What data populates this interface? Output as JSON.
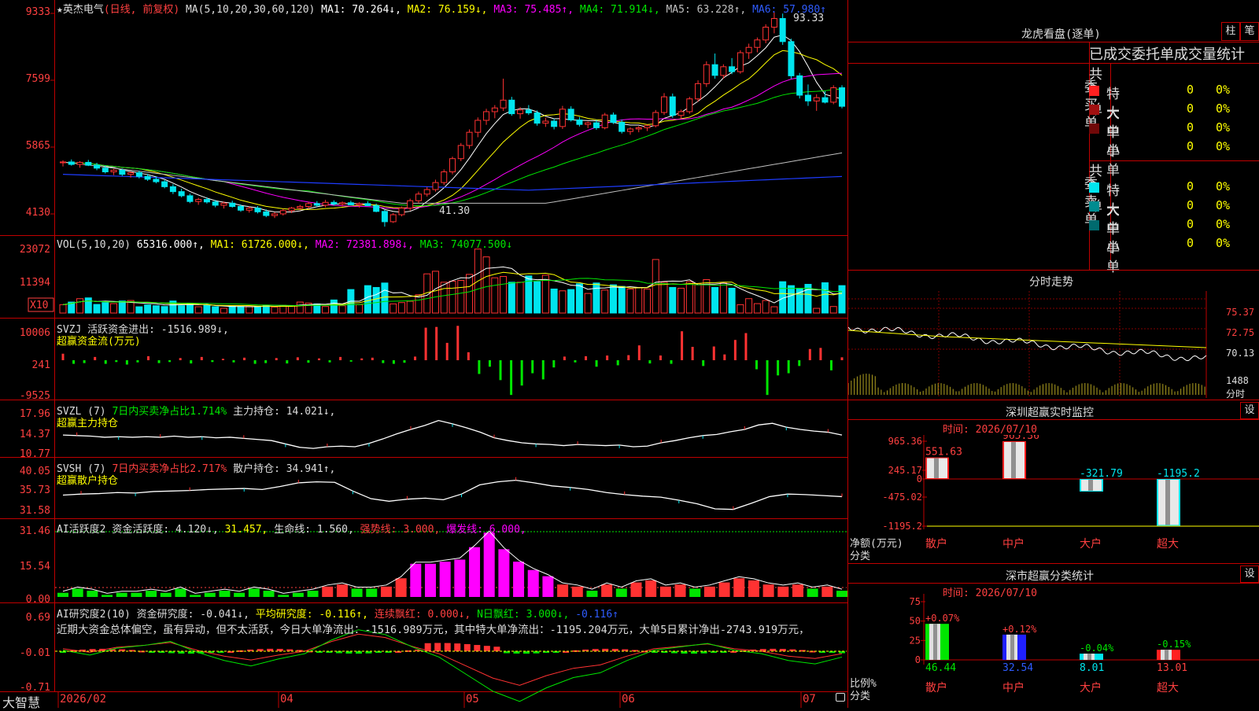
{
  "app": {
    "brand": "大智慧"
  },
  "stock": {
    "star": "★",
    "name": "英杰电气",
    "period": "(日线, 前复权)"
  },
  "colors": {
    "up": "#ff3232",
    "down": "#00e5ee",
    "axis": "#c00000",
    "grid": "#800000",
    "ma1": "#ffffff",
    "ma2": "#ffff00",
    "ma3": "#ff00ff",
    "ma4": "#00e600",
    "ma5": "#c0c0c0",
    "ma6": "#1e3cff",
    "label_red": "#ff4040"
  },
  "panels": {
    "price": {
      "header": [
        {
          "text": "MA(5,10,20,30,60,120)",
          "color": "#dddddd"
        },
        {
          "text": "MA1: 70.264↓,",
          "color": "#ffffff"
        },
        {
          "text": "MA2: 76.159↓,",
          "color": "#ffff00"
        },
        {
          "text": "MA3: 75.485↑,",
          "color": "#ff00ff"
        },
        {
          "text": "MA4: 71.914↓,",
          "color": "#00e600"
        },
        {
          "text": "MA5: 63.228↑,",
          "color": "#c0c0c0"
        },
        {
          "text": "MA6: 57.980↑",
          "color": "#2f5cff"
        }
      ],
      "y_ticks": [
        "9333",
        "7599",
        "5865",
        "4130"
      ],
      "high_label": "93.33",
      "low_label": "41.30"
    },
    "vol": {
      "header": [
        {
          "text": "VOL(5,10,20)",
          "color": "#dddddd"
        },
        {
          "text": "65316.000↑,",
          "color": "#ffffff"
        },
        {
          "text": "MA1: 61726.000↓,",
          "color": "#ffff00"
        },
        {
          "text": "MA2: 72381.898↓,",
          "color": "#ff00ff"
        },
        {
          "text": "MA3: 74077.500↓",
          "color": "#00e600"
        }
      ],
      "y_ticks": [
        "23072",
        "11394"
      ],
      "unit": "X10"
    },
    "svzj": {
      "header": [
        {
          "text": "SVZJ",
          "color": "#dddddd"
        },
        {
          "text": "活跃资金进出: -1516.989↓,",
          "color": "#dddddd"
        }
      ],
      "subtitle": "超赢资金流(万元)",
      "y_ticks": [
        "10006",
        "241",
        "-9525"
      ]
    },
    "svzl": {
      "header": [
        {
          "text": "SVZL (7)",
          "color": "#dddddd"
        },
        {
          "text": "7日内买卖净占比1.714%",
          "color": "#00e600"
        },
        {
          "text": "主力持仓: 14.021↓,",
          "color": "#dddddd"
        }
      ],
      "subtitle": "超赢主力持仓",
      "y_ticks": [
        "17.96",
        "14.37",
        "10.77"
      ]
    },
    "svsh": {
      "header": [
        {
          "text": "SVSH (7)",
          "color": "#dddddd"
        },
        {
          "text": "7日内买卖净占比2.717%",
          "color": "#ff4040"
        },
        {
          "text": "散户持仓: 34.941↑,",
          "color": "#dddddd"
        }
      ],
      "subtitle": "超赢散户持仓",
      "y_ticks": [
        "40.05",
        "35.73",
        "31.58"
      ]
    },
    "ai_active": {
      "header": [
        {
          "text": "AI活跃度2",
          "color": "#dddddd"
        },
        {
          "text": "资金活跃度: 4.120↓,",
          "color": "#dddddd"
        },
        {
          "text": "31.457,",
          "color": "#ffff00"
        },
        {
          "text": "生命线: 1.560,",
          "color": "#dddddd"
        },
        {
          "text": "强势线: 3.000,",
          "color": "#ff4040"
        },
        {
          "text": "爆发线: 6.000,",
          "color": "#ff00ff"
        }
      ],
      "y_ticks": [
        "31.46",
        "15.54",
        "0.00"
      ]
    },
    "ai_research": {
      "header": [
        {
          "text": "AI研究度2(10)",
          "color": "#dddddd"
        },
        {
          "text": "资金研究度: -0.041↓,",
          "color": "#dddddd"
        },
        {
          "text": "平均研究度: -0.116↑,",
          "color": "#ffff00"
        },
        {
          "text": "连续飘红: 0.000↓,",
          "color": "#ff4040"
        },
        {
          "text": "N日飘红: 3.000↓,",
          "color": "#00e600"
        },
        {
          "text": "-0.116↑",
          "color": "#2f5cff"
        }
      ],
      "comment": "近期大资金总体偏空，虽有异动，但不太活跃，今日大单净流出：-1516.989万元，其中特大单净流出：-1195.204万元，大单5日累计净出-2743.919万元，",
      "y_ticks": [
        "0.69",
        "-0.01",
        "-0.71"
      ]
    }
  },
  "x_axis": [
    "2026/02",
    "04",
    "05",
    "06",
    "07"
  ],
  "right": {
    "lhb": {
      "title": "龙虎看盘(逐单)",
      "btn1": "柱",
      "btn2": "笔",
      "subtitle": "已成交委托单成交量统计",
      "buy": {
        "label": "委买单",
        "total": "共 0单",
        "rows": [
          {
            "name": "特大",
            "color": "#ff2020",
            "val": "0",
            "pct": "0%"
          },
          {
            "name": "大单",
            "color": "#a01010",
            "val": "0",
            "pct": "0%"
          },
          {
            "name": "中单",
            "color": "#700808",
            "val": "0",
            "pct": "0%"
          },
          {
            "name": "小单",
            "color": "",
            "val": "0",
            "pct": "0%"
          }
        ]
      },
      "sell": {
        "label": "委卖单",
        "total": "共 0单",
        "rows": [
          {
            "name": "特大",
            "color": "#00e5ee",
            "val": "0",
            "pct": "0%"
          },
          {
            "name": "大单",
            "color": "#008c90",
            "val": "0",
            "pct": "0%"
          },
          {
            "name": "中单",
            "color": "#006a6e",
            "val": "0",
            "pct": "0%"
          },
          {
            "name": "小单",
            "color": "",
            "val": "0",
            "pct": "0%"
          }
        ]
      }
    },
    "intraday": {
      "title": "分时走势",
      "y_ticks": [
        "75.37",
        "72.75",
        "70.13"
      ],
      "vol_label": "1488",
      "bottom_label": "分时"
    },
    "monitor": {
      "title": "深圳超赢实时监控",
      "btn": "设",
      "time": "时间: 2026/07/10",
      "y_ticks": [
        "965.36",
        "245.17",
        "0",
        "-475.02",
        "-1195.2"
      ],
      "ylabel": "净额(万元)",
      "xlabel": "分类",
      "chart_data": {
        "type": "bar",
        "categories": [
          "散户",
          "中户",
          "大户",
          "超大"
        ],
        "values": [
          551.63,
          965.36,
          -321.79,
          -1195.2
        ],
        "ylim": [
          -1195.2,
          965.36
        ]
      }
    },
    "classify": {
      "title": "深市超赢分类统计",
      "btn": "设",
      "time": "时间: 2026/07/10",
      "y_ticks": [
        "75",
        "50",
        "25",
        "0"
      ],
      "ylabel": "比例%",
      "xlabel": "分类",
      "chart_data": {
        "type": "bar",
        "categories": [
          "散户",
          "中户",
          "大户",
          "超大"
        ],
        "values": [
          46.44,
          32.54,
          8.01,
          13.01
        ],
        "changes": [
          "+0.07%",
          "+0.12%",
          "-0.04%",
          "-0.15%"
        ],
        "ylim": [
          0,
          75
        ],
        "colors": [
          "#00e600",
          "#2020ff",
          "#00e5ee",
          "#ff2020"
        ]
      }
    }
  },
  "chart_data": {
    "type": "candlestick",
    "ohlc": [
      [
        56.8,
        57.4,
        55.9,
        57.0
      ],
      [
        57.0,
        57.6,
        56.1,
        56.4
      ],
      [
        56.4,
        57.2,
        55.6,
        56.9
      ],
      [
        56.9,
        57.5,
        56.0,
        56.2
      ],
      [
        56.2,
        56.8,
        55.0,
        55.5
      ],
      [
        55.5,
        56.1,
        54.2,
        54.6
      ],
      [
        54.6,
        55.3,
        53.8,
        55.0
      ],
      [
        55.0,
        55.4,
        53.6,
        54.0
      ],
      [
        54.0,
        54.7,
        53.2,
        54.4
      ],
      [
        54.4,
        54.9,
        53.0,
        53.5
      ],
      [
        53.5,
        54.1,
        52.4,
        52.8
      ],
      [
        52.8,
        53.5,
        51.8,
        52.2
      ],
      [
        52.2,
        52.6,
        50.6,
        51.0
      ],
      [
        51.0,
        51.6,
        49.2,
        49.8
      ],
      [
        49.8,
        50.5,
        48.4,
        48.8
      ],
      [
        48.8,
        49.3,
        47.0,
        47.4
      ],
      [
        47.4,
        48.3,
        46.6,
        47.9
      ],
      [
        47.9,
        48.4,
        46.9,
        47.3
      ],
      [
        47.3,
        47.8,
        46.0,
        46.5
      ],
      [
        46.5,
        47.4,
        45.7,
        47.0
      ],
      [
        47.0,
        47.6,
        45.9,
        46.2
      ],
      [
        46.2,
        46.7,
        44.9,
        45.3
      ],
      [
        45.3,
        46.2,
        44.7,
        45.8
      ],
      [
        45.8,
        46.3,
        44.5,
        44.9
      ],
      [
        44.9,
        45.5,
        43.6,
        44.0
      ],
      [
        44.0,
        44.8,
        43.4,
        44.4
      ],
      [
        44.4,
        45.6,
        44.0,
        45.2
      ],
      [
        45.2,
        46.1,
        44.6,
        45.8
      ],
      [
        45.8,
        46.6,
        45.3,
        46.2
      ],
      [
        46.2,
        47.3,
        45.6,
        46.9
      ],
      [
        46.9,
        47.5,
        46.1,
        46.5
      ],
      [
        46.5,
        47.8,
        46.0,
        47.2
      ],
      [
        47.2,
        47.7,
        46.4,
        46.8
      ],
      [
        46.8,
        47.4,
        46.2,
        47.1
      ],
      [
        47.1,
        47.6,
        46.5,
        46.6
      ],
      [
        46.6,
        47.2,
        45.9,
        46.9
      ],
      [
        46.9,
        47.5,
        46.3,
        46.4
      ],
      [
        46.4,
        46.9,
        44.8,
        45.0
      ],
      [
        45.0,
        45.4,
        41.3,
        42.5
      ],
      [
        42.5,
        44.6,
        42.2,
        44.2
      ],
      [
        44.2,
        46.2,
        43.8,
        45.8
      ],
      [
        45.8,
        48.1,
        45.2,
        47.6
      ],
      [
        47.6,
        49.8,
        47.0,
        49.2
      ],
      [
        49.2,
        50.9,
        48.6,
        50.3
      ],
      [
        50.3,
        52.7,
        49.8,
        52.0
      ],
      [
        52.0,
        55.2,
        51.4,
        54.6
      ],
      [
        54.6,
        58.3,
        54.0,
        57.8
      ],
      [
        57.8,
        61.6,
        57.2,
        61.0
      ],
      [
        61.0,
        64.9,
        60.2,
        64.2
      ],
      [
        64.2,
        67.8,
        63.0,
        67.1
      ],
      [
        67.1,
        69.9,
        66.0,
        69.2
      ],
      [
        69.2,
        70.8,
        67.6,
        70.1
      ],
      [
        70.1,
        77.2,
        69.4,
        72.0
      ],
      [
        72.0,
        72.8,
        68.2,
        68.7
      ],
      [
        68.7,
        70.3,
        67.5,
        69.6
      ],
      [
        69.6,
        70.8,
        68.4,
        68.9
      ],
      [
        68.9,
        69.5,
        65.8,
        66.4
      ],
      [
        66.4,
        67.7,
        65.5,
        66.9
      ],
      [
        66.9,
        67.5,
        64.9,
        65.6
      ],
      [
        65.6,
        70.6,
        65.0,
        69.8
      ],
      [
        69.8,
        70.5,
        66.8,
        67.2
      ],
      [
        67.2,
        67.9,
        65.6,
        66.1
      ],
      [
        66.1,
        66.8,
        65.2,
        66.5
      ],
      [
        66.5,
        67.2,
        64.8,
        65.3
      ],
      [
        65.3,
        68.9,
        64.9,
        68.4
      ],
      [
        68.4,
        69.0,
        66.2,
        66.6
      ],
      [
        66.6,
        67.3,
        63.9,
        64.4
      ],
      [
        64.4,
        65.4,
        63.6,
        65.0
      ],
      [
        65.0,
        65.7,
        64.2,
        65.3
      ],
      [
        65.3,
        66.1,
        64.5,
        65.8
      ],
      [
        65.8,
        69.6,
        65.4,
        69.0
      ],
      [
        69.0,
        73.7,
        68.4,
        72.8
      ],
      [
        72.8,
        73.6,
        67.7,
        68.3
      ],
      [
        68.3,
        69.7,
        67.5,
        69.2
      ],
      [
        69.2,
        72.8,
        68.7,
        72.3
      ],
      [
        72.3,
        76.8,
        71.6,
        76.0
      ],
      [
        76.0,
        81.4,
        75.2,
        80.6
      ],
      [
        80.6,
        83.3,
        77.2,
        78.0
      ],
      [
        78.0,
        80.7,
        77.2,
        80.1
      ],
      [
        80.1,
        82.2,
        78.3,
        78.9
      ],
      [
        78.9,
        84.1,
        78.4,
        83.5
      ],
      [
        83.5,
        85.7,
        82.0,
        84.8
      ],
      [
        84.8,
        87.2,
        83.6,
        86.6
      ],
      [
        86.6,
        90.4,
        85.8,
        89.7
      ],
      [
        89.7,
        93.3,
        88.2,
        91.8
      ],
      [
        91.8,
        93.0,
        85.4,
        86.2
      ],
      [
        86.2,
        86.9,
        77.2,
        77.9
      ],
      [
        77.9,
        78.6,
        72.4,
        73.2
      ],
      [
        73.2,
        75.8,
        70.6,
        71.8
      ],
      [
        71.8,
        73.4,
        69.4,
        72.6
      ],
      [
        72.6,
        74.2,
        71.2,
        71.5
      ],
      [
        71.5,
        75.6,
        71.0,
        75.0
      ],
      [
        75.0,
        75.6,
        70.0,
        70.5
      ]
    ],
    "volume_up": [
      32,
      55,
      36,
      48,
      24,
      18,
      25,
      23,
      30,
      27,
      42,
      38,
      25,
      28,
      32,
      35,
      40,
      45,
      70,
      150,
      160,
      118,
      122,
      125,
      148,
      245,
      215,
      135,
      140,
      118,
      145,
      85,
      75,
      88,
      92,
      98,
      92,
      205,
      118,
      95,
      120,
      112,
      128,
      115
    ],
    "volume_down": [
      42,
      58,
      33,
      40,
      46,
      24,
      31,
      28,
      25,
      46,
      28,
      37,
      30,
      24,
      28,
      25,
      26,
      30,
      35,
      50,
      90,
      105,
      98,
      115,
      118,
      142,
      120,
      92,
      90,
      112,
      115,
      108,
      102,
      98,
      98,
      95,
      120,
      105,
      95,
      110,
      116,
      105,
      112,
      128,
      150,
      135,
      112,
      105,
      100,
      108,
      132,
      118,
      115,
      92
    ],
    "svzj": [
      1.8,
      -1.0,
      -0.8,
      0.9,
      -1.0,
      -0.5,
      -1.2,
      -0.6,
      1.1,
      -0.8,
      -0.5,
      0.6,
      -0.9,
      0.9,
      -0.5,
      0.4,
      -0.6,
      0.7,
      -1.0,
      -0.8,
      0.6,
      -0.9,
      0.8,
      -0.7,
      0.5,
      -0.6,
      0.9,
      -0.4,
      0.5,
      0.7,
      -0.8,
      -1.0,
      -0.7,
      1.0,
      9.0,
      9.2,
      4.8,
      9.5,
      2.2,
      -3.8,
      -1.8,
      -5.5,
      -9.6,
      -7.0,
      -3.6,
      -5.3,
      -2.0,
      1.0,
      -0.6,
      1.1,
      -1.8,
      1.3,
      -1.4,
      1.4,
      4.1,
      -0.9,
      1.3,
      -1.0,
      8.0,
      3.7,
      -1.6,
      3.8,
      1.6,
      5.6,
      7.5,
      -2.5,
      -9.6,
      -4.2,
      -3.6,
      -1.6,
      3.1,
      3.4,
      -2.8,
      0.8
    ],
    "svzl": [
      14.0,
      13.9,
      13.8,
      13.6,
      13.7,
      13.6,
      13.7,
      13.6,
      13.8,
      13.6,
      13.7,
      13.5,
      13.6,
      13.4,
      13.2,
      13.0,
      12.4,
      11.8,
      11.6,
      11.9,
      12.0,
      11.9,
      12.5,
      13.3,
      14.2,
      15.0,
      15.7,
      16.6,
      16.0,
      15.3,
      14.5,
      13.5,
      13.0,
      12.6,
      12.4,
      12.3,
      12.1,
      12.3,
      12.2,
      12.1,
      12.2,
      11.9,
      12.0,
      12.6,
      13.0,
      13.5,
      13.9,
      14.1,
      14.6,
      15.0,
      15.8,
      16.1,
      15.4,
      15.0,
      14.7,
      14.5,
      14.0
    ],
    "svsh": [
      35.2,
      35.4,
      35.5,
      35.7,
      35.6,
      35.9,
      36.0,
      36.1,
      36.3,
      36.4,
      36.5,
      36.3,
      36.9,
      37.6,
      37.8,
      37.7,
      36.0,
      34.5,
      34.0,
      34.4,
      34.6,
      34.3,
      35.4,
      37.2,
      37.8,
      38.1,
      37.6,
      37.0,
      36.7,
      36.3,
      35.7,
      35.3,
      35.0,
      34.8,
      34.2,
      33.5,
      32.5,
      32.4,
      33.6,
      34.9,
      35.4,
      35.3,
      35.1,
      34.9
    ],
    "ai_active": [
      2,
      4,
      3,
      1,
      2,
      2,
      3,
      2,
      4,
      1,
      2,
      3,
      2,
      4,
      3,
      1,
      2,
      3,
      5,
      6,
      4,
      4,
      5,
      9,
      16,
      16,
      17,
      18,
      24,
      31,
      23,
      17,
      13,
      10,
      6,
      5,
      3,
      6,
      4,
      7,
      8,
      5,
      6,
      4,
      5,
      7,
      9,
      8,
      6,
      5,
      6,
      4,
      5,
      3
    ],
    "ai_research": [
      0.05,
      -0.02,
      0.08,
      0.12,
      0.18,
      0.02,
      -0.1,
      -0.18,
      -0.08,
      0.0,
      0.2,
      0.35,
      0.28,
      0.1,
      -0.05,
      -0.3,
      -0.55,
      -0.7,
      -0.5,
      -0.35,
      -0.28,
      -0.1,
      0.05,
      0.1,
      0.15,
      0.05,
      0.0,
      -0.1,
      -0.15,
      -0.05
    ]
  }
}
